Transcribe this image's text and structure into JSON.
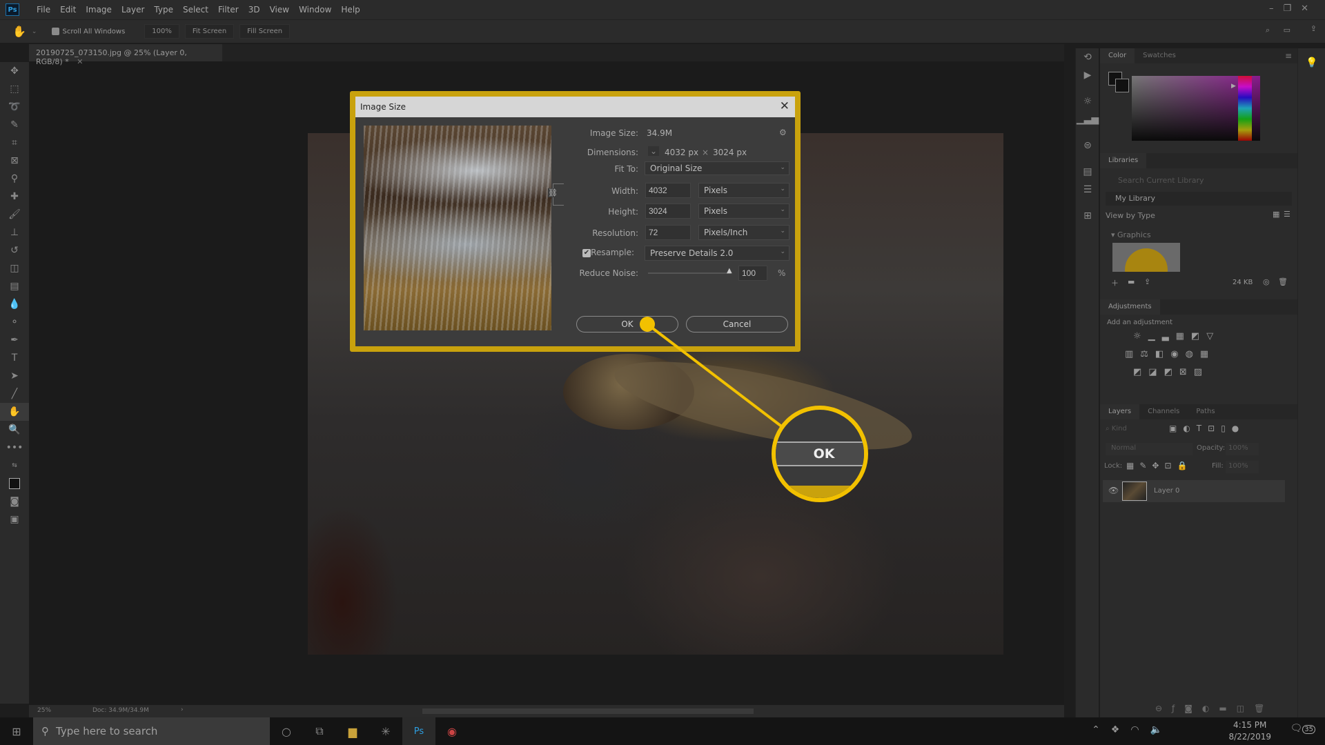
{
  "menubar": {
    "logo": "Ps",
    "items": [
      "File",
      "Edit",
      "Image",
      "Layer",
      "Type",
      "Select",
      "Filter",
      "3D",
      "View",
      "Window",
      "Help"
    ]
  },
  "options": {
    "scroll_all": "Scroll All Windows",
    "zoom100": "100%",
    "fit": "Fit Screen",
    "fill": "Fill Screen"
  },
  "document_tab": {
    "title": "20190725_073150.jpg @ 25% (Layer 0, RGB/8) *"
  },
  "status": {
    "zoom": "25%",
    "doc": "Doc: 34.9M/34.9M"
  },
  "panels": {
    "color_tabs": [
      "Color",
      "Swatches"
    ],
    "libraries": {
      "tab": "Libraries",
      "search_placeholder": "Search Current Library",
      "library": "My Library",
      "view_by": "View by Type",
      "section": "Graphics",
      "size": "24 KB"
    },
    "adjustments": {
      "tab": "Adjustments",
      "hint": "Add an adjustment"
    },
    "layers": {
      "tabs": [
        "Layers",
        "Channels",
        "Paths"
      ],
      "kind": "Kind",
      "blend": "Normal",
      "opacity_label": "Opacity:",
      "opacity": "100%",
      "lock_label": "Lock:",
      "fill_label": "Fill:",
      "fill": "100%",
      "layer_name": "Layer 0"
    }
  },
  "dialog": {
    "title": "Image Size",
    "image_size_label": "Image Size:",
    "image_size": "34.9M",
    "dimensions_label": "Dimensions:",
    "dim_w": "4032 px",
    "dim_x": "×",
    "dim_h": "3024 px",
    "fit_label": "Fit To:",
    "fit": "Original Size",
    "width_label": "Width:",
    "width": "4032",
    "width_unit": "Pixels",
    "height_label": "Height:",
    "height": "3024",
    "height_unit": "Pixels",
    "res_label": "Resolution:",
    "resolution": "72",
    "res_unit": "Pixels/Inch",
    "resample_label": "Resample:",
    "resample_checked": true,
    "resample": "Preserve Details 2.0",
    "noise_label": "Reduce Noise:",
    "noise": "100",
    "noise_unit": "%",
    "ok": "OK",
    "cancel": "Cancel"
  },
  "callout": {
    "text": "OK",
    "color": "#f2c100"
  },
  "taskbar": {
    "search_placeholder": "Type here to search",
    "time": "4:15 PM",
    "date": "8/22/2019",
    "notifications": "35"
  },
  "colors": {
    "highlight": "#c9a20d",
    "callout": "#f2c100"
  }
}
